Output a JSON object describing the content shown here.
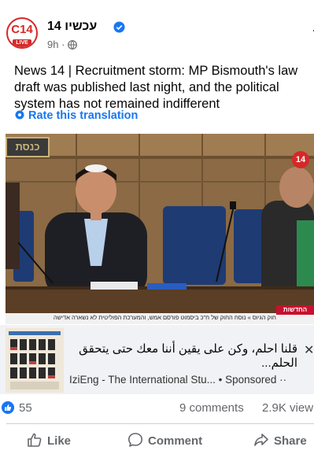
{
  "post": {
    "page_name": "עכשיו 14",
    "avatar_text": "C14",
    "avatar_live": "LIVE",
    "time": "9h",
    "meta_separator": "·",
    "text": "News 14 | Recruitment storm: MP Bismouth's law draft was published last night, and the political system has not remained indifferent",
    "translate_label": "Rate this translation"
  },
  "photo": {
    "sign_text": "כנסת",
    "channel_logo": "14",
    "ticker_text": "חוק הגיוס » נוסח החוק של ח\"כ ביסמוט פורסם אמש, והמערכת הפוליטית לא נשארה אדישה",
    "ticker_badge": "החדשות"
  },
  "ad": {
    "headline": "قلنا احلم، وكن على يقين أننا معك حتى يتحقق الحلم...",
    "source": "IziEng - The International Stu...",
    "sponsored": "• Sponsored",
    "more": "··"
  },
  "stats": {
    "likes": "55",
    "comments": "9 comments",
    "views": "2.9K view"
  },
  "actions": {
    "like": "Like",
    "comment": "Comment",
    "share": "Share"
  },
  "colors": {
    "brand_red": "#d62828",
    "link_blue": "#1877f2",
    "muted": "#65676b"
  }
}
